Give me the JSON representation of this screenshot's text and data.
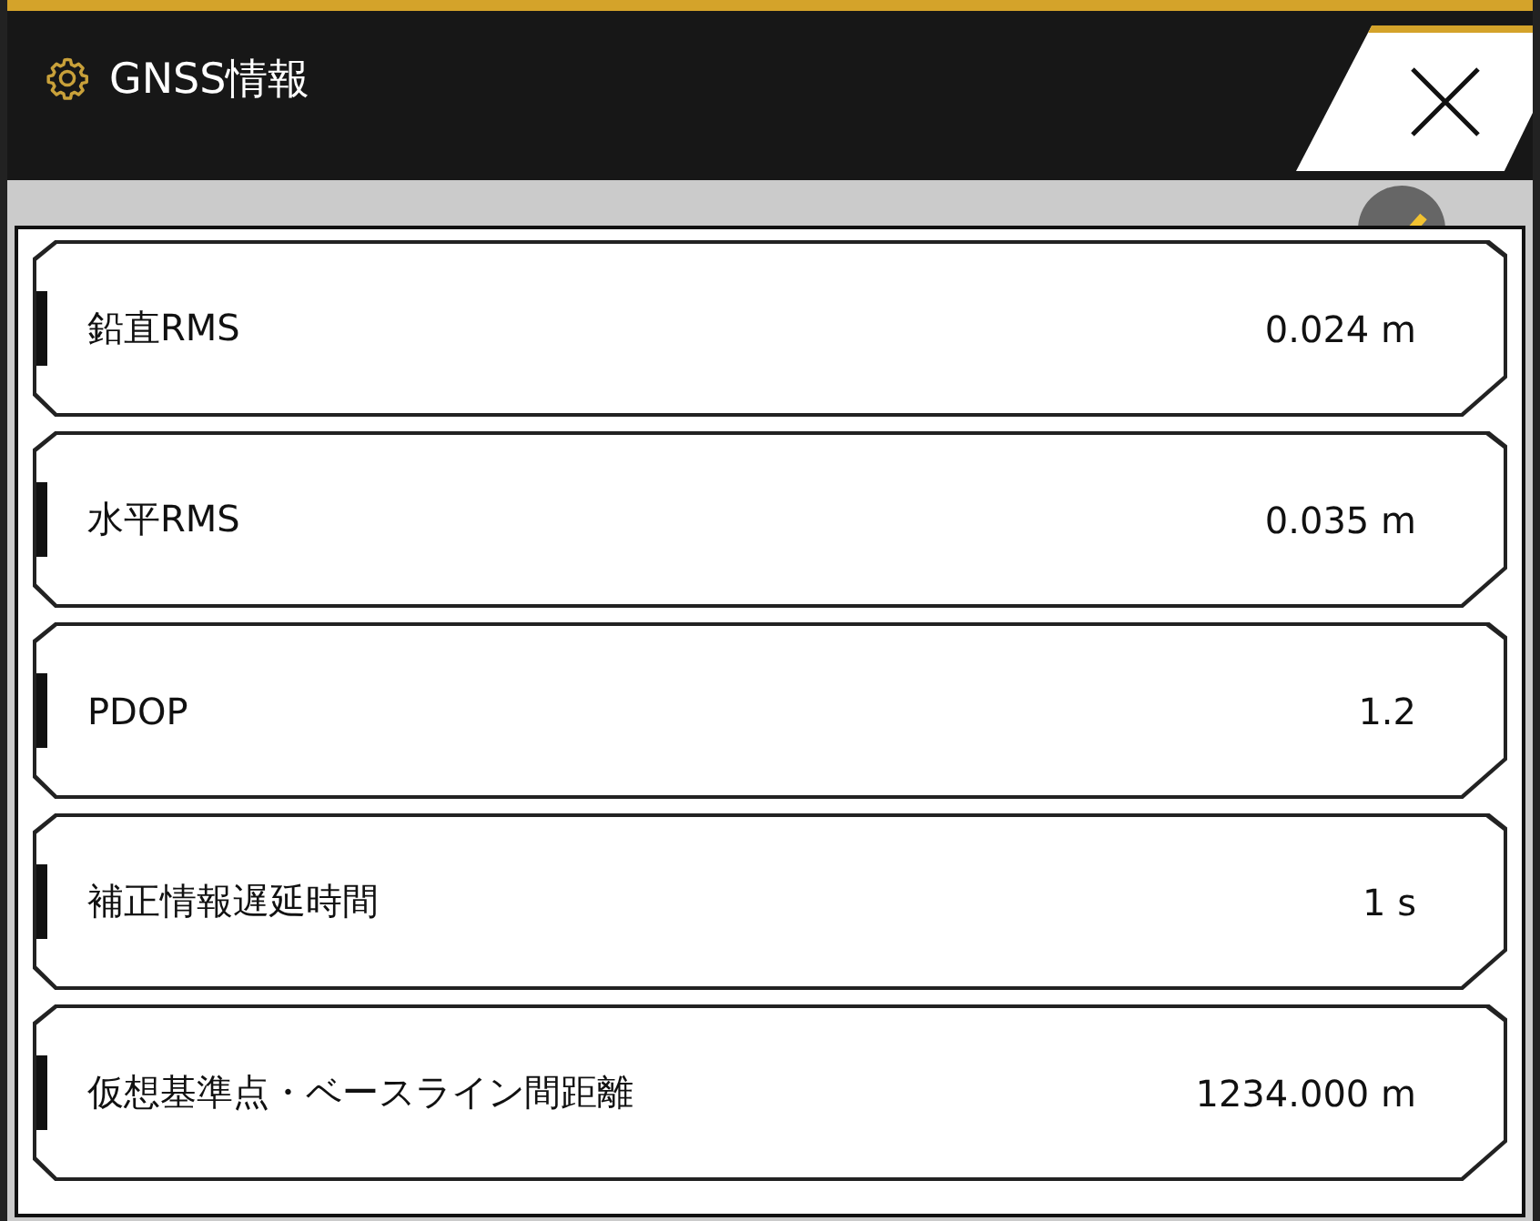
{
  "window": {
    "title": "GNSS情報"
  },
  "rows": [
    {
      "label": "鉛直RMS",
      "value": "0.024 m"
    },
    {
      "label": "水平RMS",
      "value": "0.035 m"
    },
    {
      "label": "PDOP",
      "value": "1.2"
    },
    {
      "label": "補正情報遅延時間",
      "value": "1 s"
    },
    {
      "label": "仮想基準点・ベースライン間距離",
      "value": "1234.000 m"
    }
  ]
}
